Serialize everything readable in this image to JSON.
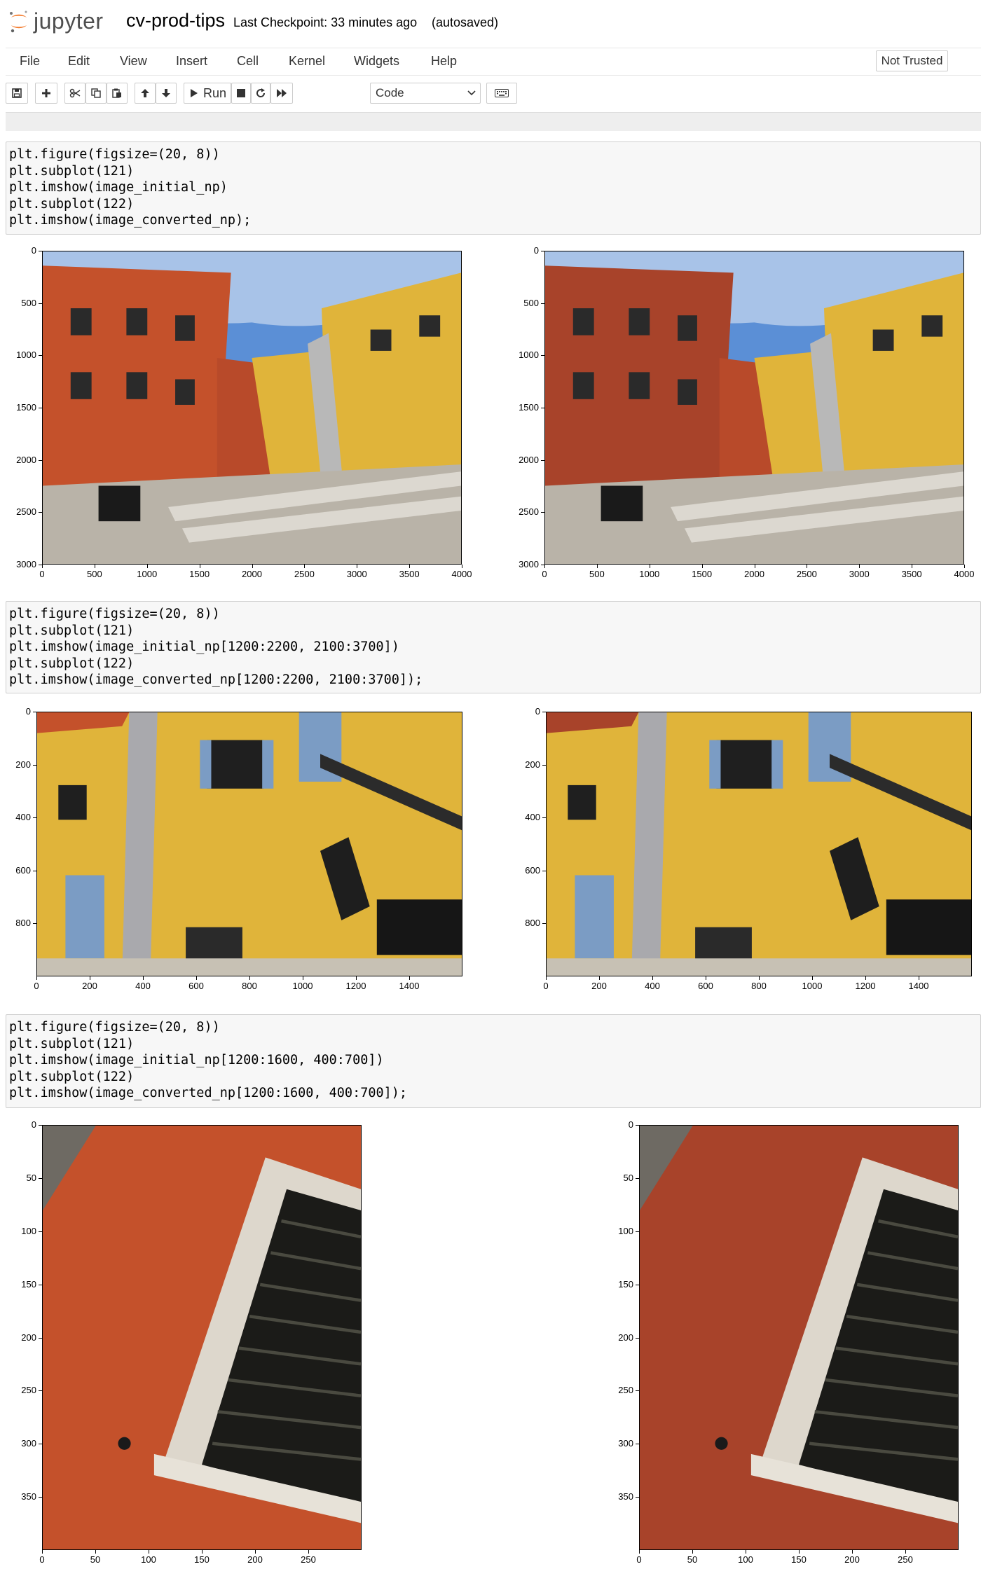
{
  "header": {
    "logo_text": "jupyter",
    "notebook_name": "cv-prod-tips",
    "checkpoint": "Last Checkpoint: 33 minutes ago",
    "autosaved": "(autosaved)"
  },
  "menu": {
    "items": [
      "File",
      "Edit",
      "View",
      "Insert",
      "Cell",
      "Kernel",
      "Widgets",
      "Help"
    ],
    "trusted": "Not Trusted"
  },
  "toolbar": {
    "run_label": "Run",
    "cell_type": "Code",
    "icons": [
      "save-icon",
      "plus-icon",
      "cut-icon",
      "copy-icon",
      "paste-icon",
      "arrow-up-icon",
      "arrow-down-icon",
      "run-icon",
      "stop-icon",
      "restart-icon",
      "fast-forward-icon",
      "keyboard-icon"
    ]
  },
  "cells": [
    {
      "code": "plt.figure(figsize=(20, 8))\nplt.subplot(121)\nplt.imshow(image_initial_np)\nplt.subplot(122)\nplt.imshow(image_converted_np);",
      "yticks": [
        "0",
        "500",
        "1000",
        "1500",
        "2000",
        "2500",
        "3000"
      ],
      "xticks": [
        "0",
        "500",
        "1000",
        "1500",
        "2000",
        "2500",
        "3000",
        "3500",
        "4000"
      ]
    },
    {
      "code": "plt.figure(figsize=(20, 8))\nplt.subplot(121)\nplt.imshow(image_initial_np[1200:2200, 2100:3700])\nplt.subplot(122)\nplt.imshow(image_converted_np[1200:2200, 2100:3700]);",
      "yticks": [
        "0",
        "200",
        "400",
        "600",
        "800"
      ],
      "xticks": [
        "0",
        "200",
        "400",
        "600",
        "800",
        "1000",
        "1200",
        "1400"
      ]
    },
    {
      "code": "plt.figure(figsize=(20, 8))\nplt.subplot(121)\nplt.imshow(image_initial_np[1200:1600, 400:700])\nplt.subplot(122)\nplt.imshow(image_converted_np[1200:1600, 400:700]);",
      "yticks": [
        "0",
        "50",
        "100",
        "150",
        "200",
        "250",
        "300",
        "350"
      ],
      "xticks": [
        "0",
        "50",
        "100",
        "150",
        "200",
        "250"
      ]
    }
  ],
  "colors": {
    "orange_wall": "#c4512b",
    "yellow_wall": "#e0b43a",
    "sky": "#5b8fd6",
    "converted_wall": "#a8432a",
    "shutter_blue": "#7b9cc4"
  }
}
